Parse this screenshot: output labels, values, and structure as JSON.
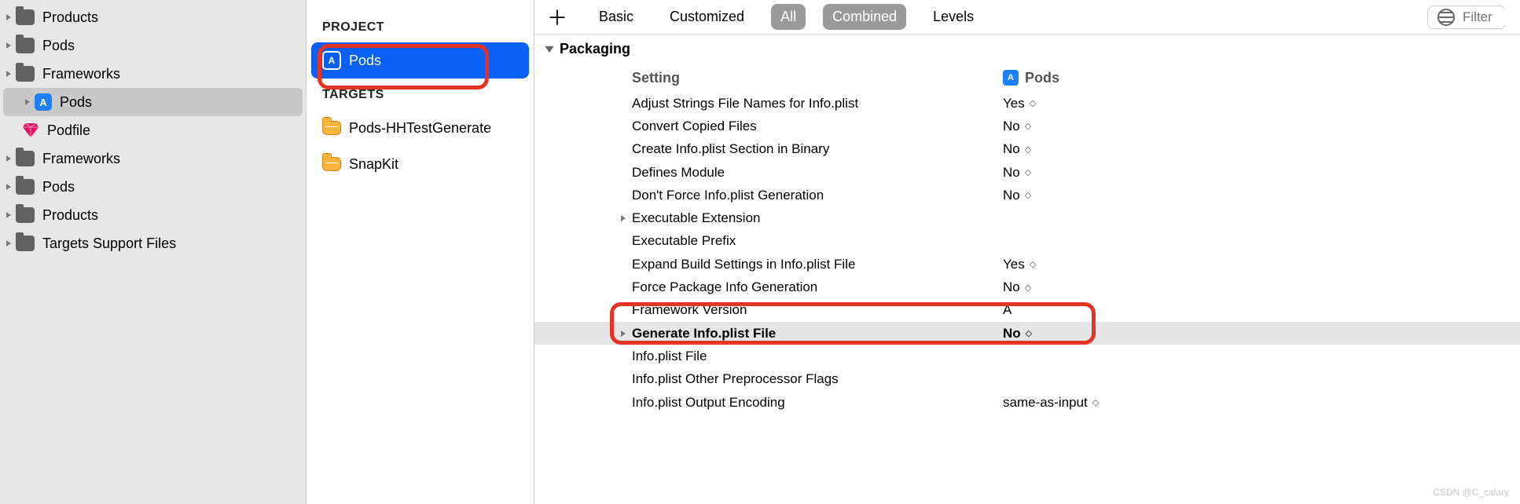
{
  "navigator": {
    "items": [
      {
        "label": "Products",
        "type": "folder",
        "indent": 0
      },
      {
        "label": "Pods",
        "type": "folder",
        "indent": 0
      },
      {
        "label": "Frameworks",
        "type": "folder",
        "indent": 0
      },
      {
        "label": "Pods",
        "type": "project",
        "indent": 0,
        "selected": true
      },
      {
        "label": "Podfile",
        "type": "ruby",
        "indent": 1
      },
      {
        "label": "Frameworks",
        "type": "folder",
        "indent": 0
      },
      {
        "label": "Pods",
        "type": "folder",
        "indent": 0
      },
      {
        "label": "Products",
        "type": "folder",
        "indent": 0
      },
      {
        "label": "Targets Support Files",
        "type": "folder",
        "indent": 0
      }
    ]
  },
  "middle": {
    "project_header": "PROJECT",
    "targets_header": "TARGETS",
    "project": {
      "label": "Pods"
    },
    "targets": [
      {
        "label": "Pods-HHTestGenerate"
      },
      {
        "label": "SnapKit"
      }
    ]
  },
  "toolbar": {
    "basic": "Basic",
    "customized": "Customized",
    "all": "All",
    "combined": "Combined",
    "levels": "Levels",
    "filter_placeholder": "Filter"
  },
  "section": {
    "title": "Packaging"
  },
  "table": {
    "header_setting": "Setting",
    "header_value_label": "Pods",
    "rows": [
      {
        "setting": "Adjust Strings File Names for Info.plist",
        "value": "Yes",
        "dd": true
      },
      {
        "setting": "Convert Copied Files",
        "value": "No",
        "dd": true
      },
      {
        "setting": "Create Info.plist Section in Binary",
        "value": "No",
        "dd": true
      },
      {
        "setting": "Defines Module",
        "value": "No",
        "dd": true
      },
      {
        "setting": "Don't Force Info.plist Generation",
        "value": "No",
        "dd": true
      },
      {
        "setting": "Executable Extension",
        "value": "",
        "arrow": true
      },
      {
        "setting": "Executable Prefix",
        "value": ""
      },
      {
        "setting": "Expand Build Settings in Info.plist File",
        "value": "Yes",
        "dd": true
      },
      {
        "setting": "Force Package Info Generation",
        "value": "No",
        "dd": true
      },
      {
        "setting": "Framework Version",
        "value": "A"
      },
      {
        "setting": "Generate Info.plist File",
        "value": "No",
        "dd": true,
        "arrow": true,
        "highlighted": true
      },
      {
        "setting": "Info.plist File",
        "value": ""
      },
      {
        "setting": "Info.plist Other Preprocessor Flags",
        "value": ""
      },
      {
        "setting": "Info.plist Output Encoding",
        "value": "same-as-input",
        "dd": true
      }
    ]
  },
  "watermark": "CSDN @C_calary"
}
